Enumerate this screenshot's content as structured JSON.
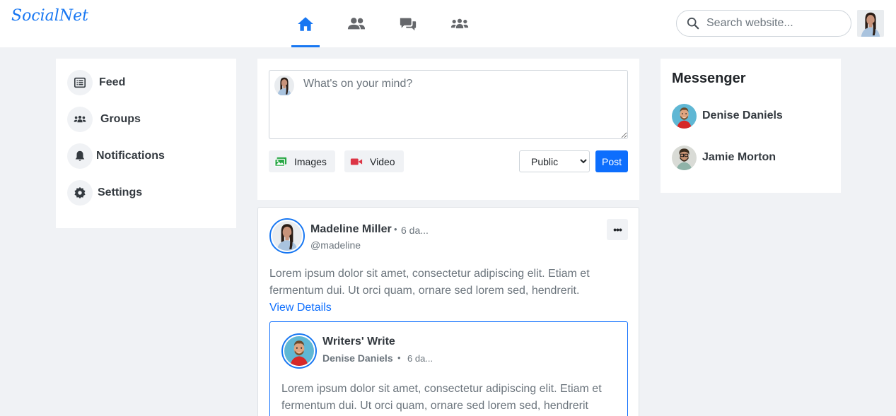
{
  "brand": "SocialNet",
  "nav": {
    "icons": [
      "home-icon",
      "friends-icon",
      "chats-icon",
      "groups-icon"
    ],
    "active": "home-icon",
    "search_placeholder": "Search website..."
  },
  "sidebar": {
    "items": [
      {
        "label": "Feed",
        "icon": "feed-icon"
      },
      {
        "label": "Groups",
        "icon": "groups-icon"
      },
      {
        "label": "Notifications",
        "icon": "bell-icon"
      },
      {
        "label": "Settings",
        "icon": "gear-icon"
      }
    ]
  },
  "composer": {
    "placeholder": "What's on your mind?",
    "images_label": "Images",
    "video_label": "Video",
    "privacy_selected": "Public",
    "post_label": "Post"
  },
  "post": {
    "author": "Madeline Miller",
    "dot": "•",
    "time": "6 da...",
    "handle": "@madeline",
    "more": "•••",
    "body": "Lorem ipsum dolor sit amet, consectetur adipiscing elit. Etiam et fermentum dui. Ut orci quam, ornare sed lorem sed, hendrerit.",
    "link": "View Details",
    "shared": {
      "group": "Writers' Write",
      "author": "Denise Daniels",
      "dot": "•",
      "time": "6 da...",
      "body": "Lorem ipsum dolor sit amet, consectetur adipiscing elit. Etiam et fermentum dui. Ut orci quam, ornare sed lorem sed, hendrerit"
    }
  },
  "messenger": {
    "title": "Messenger",
    "contacts": [
      {
        "name": "Denise Daniels"
      },
      {
        "name": "Jamie Morton"
      }
    ]
  },
  "colors": {
    "accent": "#1877f2",
    "primary_button": "#0d6efd",
    "background": "#f0f2f5",
    "muted_text": "#6c757d"
  }
}
